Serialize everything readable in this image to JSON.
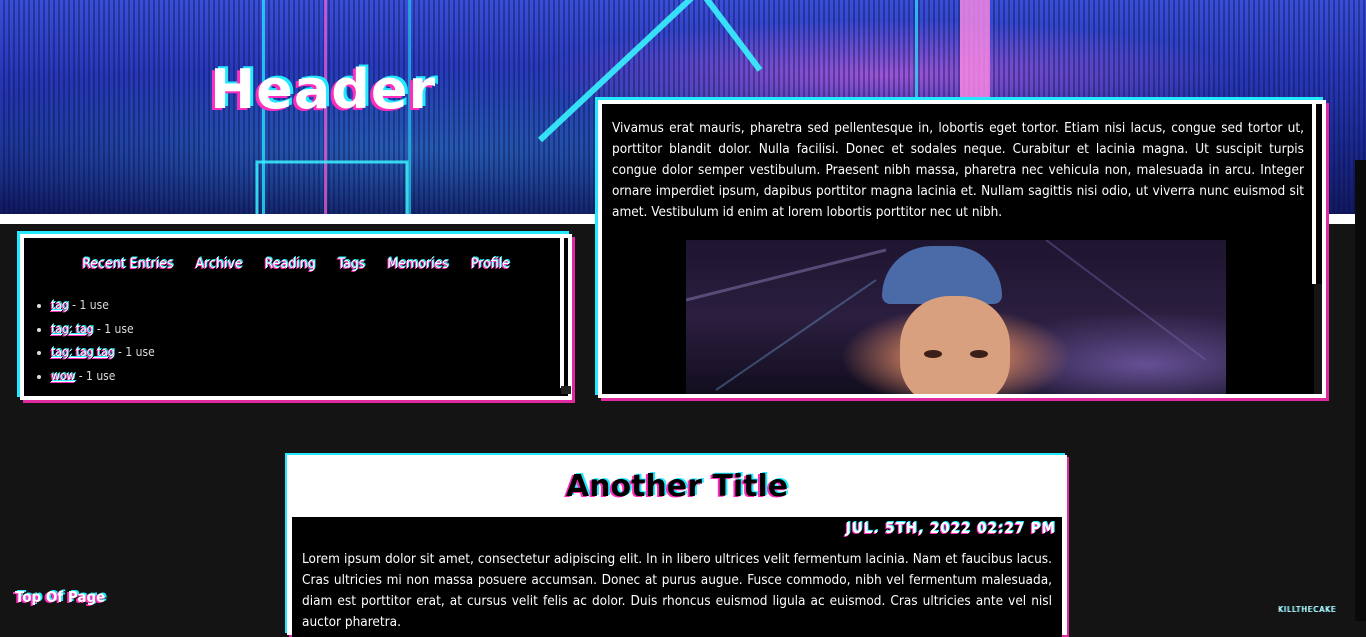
{
  "header": {
    "title": "Header"
  },
  "nav": {
    "links": [
      "Recent Entries",
      "Archive",
      "Reading",
      "Tags",
      "Memories",
      "Profile"
    ]
  },
  "tags": [
    {
      "name": "tag",
      "count": " - 1 use"
    },
    {
      "name": "tag: tag",
      "count": " - 1 use"
    },
    {
      "name": "tag: tag tag",
      "count": " - 1 use"
    },
    {
      "name": "wow",
      "count": " - 1 use"
    }
  ],
  "intro": {
    "text": "Vivamus erat mauris, pharetra sed pellentesque in, lobortis eget tortor. Etiam nisi lacus, congue sed tortor ut, porttitor blandit dolor. Nulla facilisi. Donec et sodales neque. Curabitur et lacinia magna. Ut suscipit turpis congue dolor semper vestibulum. Praesent nibh massa, pharetra nec vehicula non, malesuada in arcu. Integer ornare imperdiet ipsum, dapibus porttitor magna lacinia et. Nullam sagittis nisi odio, ut viverra nunc euismod sit amet. Vestibulum id enim at lorem lobortis porttitor nec ut nibh."
  },
  "post": {
    "title": "Another Title",
    "date": "Jul. 5th, 2022 02:27 pm",
    "text": "Lorem ipsum dolor sit amet, consectetur adipiscing elit. In in libero ultrices velit fermentum lacinia. Nam et faucibus lacus. Cras ultricies mi non massa posuere accumsan. Donec at purus augue. Fusce commodo, nibh vel fermentum malesuada, diam est porttitor erat, at cursus velit felis ac dolor. Duis rhoncus euismod ligula ac euismod. Cras ultricies ante vel nisl auctor pharetra."
  },
  "footer": {
    "top_link": "Top Of Page",
    "credit": "KILLTHECAKE"
  },
  "colors": {
    "cyan": "#23e8ff",
    "magenta": "#e0299f",
    "background": "#141414"
  }
}
